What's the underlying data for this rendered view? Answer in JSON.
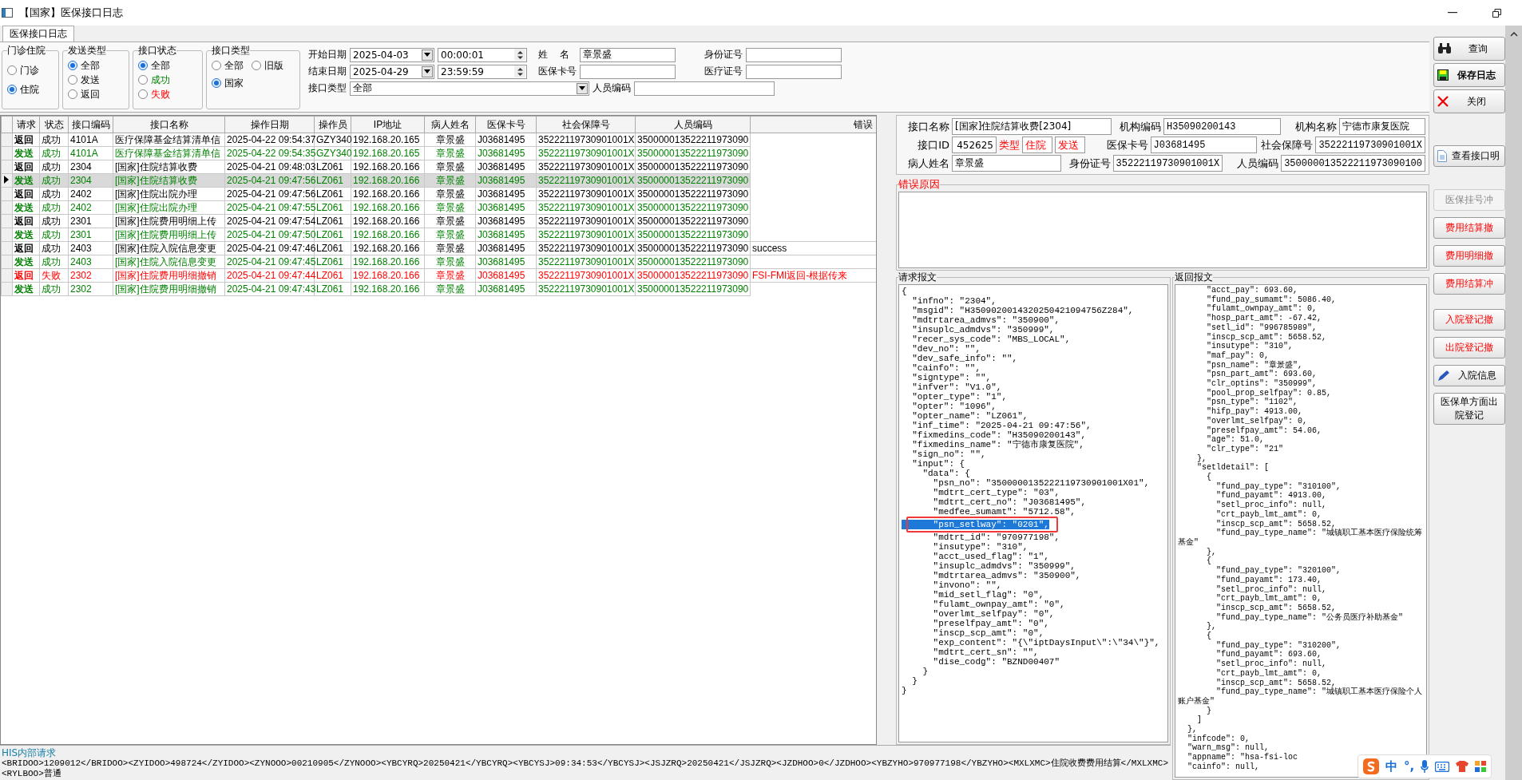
{
  "window": {
    "title": "【国家】医保接口日志"
  },
  "tabs": [
    {
      "label": "医保接口日志",
      "selected": true
    }
  ],
  "filters": {
    "groups": [
      {
        "title": "门诊住院",
        "options": [
          {
            "label": "门诊",
            "selected": false
          },
          {
            "label": "住院",
            "selected": true
          }
        ]
      },
      {
        "title": "发送类型",
        "options": [
          {
            "label": "全部",
            "selected": true
          },
          {
            "label": "发送",
            "selected": false
          },
          {
            "label": "返回",
            "selected": false
          }
        ]
      },
      {
        "title": "接口状态",
        "options": [
          {
            "label": "全部",
            "selected": true
          },
          {
            "label": "成功",
            "selected": false,
            "color": "#008000"
          },
          {
            "label": "失败",
            "selected": false,
            "color": "#ff0000"
          }
        ]
      },
      {
        "title": "接口类型",
        "options": [
          {
            "label": "全部",
            "selected": false
          },
          {
            "label": "旧版",
            "selected": false
          },
          {
            "label": "国家",
            "selected": true
          }
        ]
      }
    ],
    "start_label": "开始日期",
    "start_date": "2025-04-03",
    "start_time": "00:00:01",
    "end_label": "结束日期",
    "end_date": "2025-04-29",
    "end_time": "23:59:59",
    "type_label": "接口类型",
    "type_value": "全部",
    "name_label": "姓    名",
    "name_value": "章景盛",
    "card_label": "医保卡号",
    "id_label": "身份证号",
    "medical_label": "医疗证号",
    "person_label": "人员编码"
  },
  "table": {
    "columns": [
      "请求",
      "状态",
      "接口编码",
      "接口名称",
      "操作日期",
      "操作员",
      "IP地址",
      "病人姓名",
      "医保卡号",
      "社会保障号",
      "人员编码",
      "错误"
    ],
    "rows": [
      {
        "kind": "return",
        "selected": false,
        "cells": [
          "返回",
          "成功",
          "4101A",
          "医疗保障基金结算清单信",
          "2025-04-22 09:54:37",
          "GZY340",
          "192.168.20.165",
          "章景盛",
          "J03681495",
          "35222119730901001X",
          "350000013522211973090"
        ]
      },
      {
        "kind": "send",
        "selected": false,
        "cells": [
          "发送",
          "成功",
          "4101A",
          "医疗保障基金结算清单信",
          "2025-04-22 09:54:35",
          "GZY340",
          "192.168.20.165",
          "章景盛",
          "J03681495",
          "35222119730901001X",
          "350000013522211973090"
        ]
      },
      {
        "kind": "return",
        "selected": false,
        "cells": [
          "返回",
          "成功",
          "2304",
          "[国家]住院结算收费",
          "2025-04-21 09:48:03",
          "LZ061",
          "192.168.20.166",
          "章景盛",
          "J03681495",
          "35222119730901001X",
          "350000013522211973090"
        ]
      },
      {
        "kind": "send",
        "selected": true,
        "cells": [
          "发送",
          "成功",
          "2304",
          "[国家]住院结算收费",
          "2025-04-21 09:47:56",
          "LZ061",
          "192.168.20.166",
          "章景盛",
          "J03681495",
          "35222119730901001X",
          "350000013522211973090"
        ]
      },
      {
        "kind": "return",
        "selected": false,
        "cells": [
          "返回",
          "成功",
          "2402",
          "[国家]住院出院办理",
          "2025-04-21 09:47:56",
          "LZ061",
          "192.168.20.166",
          "章景盛",
          "J03681495",
          "35222119730901001X",
          "350000013522211973090"
        ]
      },
      {
        "kind": "send",
        "selected": false,
        "cells": [
          "发送",
          "成功",
          "2402",
          "[国家]住院出院办理",
          "2025-04-21 09:47:55",
          "LZ061",
          "192.168.20.166",
          "章景盛",
          "J03681495",
          "35222119730901001X",
          "350000013522211973090"
        ]
      },
      {
        "kind": "return",
        "selected": false,
        "cells": [
          "返回",
          "成功",
          "2301",
          "[国家]住院费用明细上传",
          "2025-04-21 09:47:54",
          "LZ061",
          "192.168.20.166",
          "章景盛",
          "J03681495",
          "35222119730901001X",
          "350000013522211973090"
        ]
      },
      {
        "kind": "send",
        "selected": false,
        "cells": [
          "发送",
          "成功",
          "2301",
          "[国家]住院费用明细上传",
          "2025-04-21 09:47:50",
          "LZ061",
          "192.168.20.166",
          "章景盛",
          "J03681495",
          "35222119730901001X",
          "350000013522211973090"
        ]
      },
      {
        "kind": "return",
        "selected": false,
        "cells": [
          "返回",
          "成功",
          "2403",
          "[国家]住院入院信息变更",
          "2025-04-21 09:47:46",
          "LZ061",
          "192.168.20.166",
          "章景盛",
          "J03681495",
          "35222119730901001X",
          "350000013522211973090",
          "success"
        ]
      },
      {
        "kind": "send",
        "selected": false,
        "cells": [
          "发送",
          "成功",
          "2403",
          "[国家]住院入院信息变更",
          "2025-04-21 09:47:45",
          "LZ061",
          "192.168.20.166",
          "章景盛",
          "J03681495",
          "35222119730901001X",
          "350000013522211973090"
        ]
      },
      {
        "kind": "failed",
        "selected": false,
        "cells": [
          "返回",
          "失败",
          "2302",
          "[国家]住院费用明细撤销",
          "2025-04-21 09:47:44",
          "LZ061",
          "192.168.20.166",
          "章景盛",
          "J03681495",
          "35222119730901001X",
          "350000013522211973090",
          "FSI-FMI返回-根据传来"
        ]
      },
      {
        "kind": "send",
        "selected": false,
        "cells": [
          "发送",
          "成功",
          "2302",
          "[国家]住院费用明细撤销",
          "2025-04-21 09:47:43",
          "LZ061",
          "192.168.20.166",
          "章景盛",
          "J03681495",
          "35222119730901001X",
          "350000013522211973090"
        ]
      }
    ]
  },
  "detail": {
    "rows": [
      {
        "cells": [
          {
            "label": "接口名称",
            "value": "[国家]住院结算收费[2304]"
          },
          {
            "label": "机构编码",
            "value": "H35090200143"
          },
          {
            "label": "机构名称",
            "value": "宁德市康复医院"
          }
        ]
      },
      {
        "cells": [
          {
            "label": "接口ID",
            "value": "452625",
            "kind": "id"
          },
          {
            "label": "医保卡号",
            "value": "J03681495"
          },
          {
            "label": "社会保障号",
            "value": "35222119730901001X"
          }
        ]
      },
      {
        "cells": [
          {
            "label": "病人姓名",
            "value": "章景盛"
          },
          {
            "label": "身份证号",
            "value": "35222119730901001X"
          },
          {
            "label": "人员编码",
            "value": "350000013522211973090100"
          }
        ]
      }
    ],
    "type_label": "类型",
    "visit_type": "住院",
    "direction": "发送",
    "error_title": "错误原因"
  },
  "request": {
    "title": "请求报文",
    "lines": [
      {
        "text": "{",
        "selected": false
      },
      {
        "text": "  \"infno\": \"2304\",",
        "selected": false
      },
      {
        "text": "  \"msgid\": \"H3509020014320250421094756Z284\",",
        "selected": false
      },
      {
        "text": "  \"mdtrtarea_admvs\": \"350900\",",
        "selected": false
      },
      {
        "text": "  \"insuplc_admdvs\": \"350999\",",
        "selected": false
      },
      {
        "text": "  \"recer_sys_code\": \"MBS_LOCAL\",",
        "selected": false
      },
      {
        "text": "  \"dev_no\": \"\",",
        "selected": false
      },
      {
        "text": "  \"dev_safe_info\": \"\",",
        "selected": false
      },
      {
        "text": "  \"cainfo\": \"\",",
        "selected": false
      },
      {
        "text": "  \"signtype\": \"\",",
        "selected": false
      },
      {
        "text": "  \"infver\": \"V1.0\",",
        "selected": false
      },
      {
        "text": "  \"opter_type\": \"1\",",
        "selected": false
      },
      {
        "text": "  \"opter\": \"1096\",",
        "selected": false
      },
      {
        "text": "  \"opter_name\": \"LZ061\",",
        "selected": false
      },
      {
        "text": "  \"inf_time\": \"2025-04-21 09:47:56\",",
        "selected": false
      },
      {
        "text": "  \"fixmedins_code\": \"H35090200143\",",
        "selected": false
      },
      {
        "text": "  \"fixmedins_name\": \"宁德市康复医院\",",
        "selected": false
      },
      {
        "text": "  \"sign_no\": \"\",",
        "selected": false
      },
      {
        "text": "  \"input\": {",
        "selected": false
      },
      {
        "text": "    \"data\": {",
        "selected": false
      },
      {
        "text": "      \"psn_no\": \"3500000135222119730901001X01\",",
        "selected": false
      },
      {
        "text": "      \"mdtrt_cert_type\": \"03\",",
        "selected": false
      },
      {
        "text": "      \"mdtrt_cert_no\": \"J03681495\",",
        "selected": false
      },
      {
        "text": "      \"medfee_sumamt\": \"5712.58\",",
        "selected": false
      },
      {
        "text": "      \"psn_setlway\": \"0201\",",
        "selected": true
      },
      {
        "text": "      \"mdtrt_id\": \"970977198\",",
        "selected": false
      },
      {
        "text": "      \"insutype\": \"310\",",
        "selected": false
      },
      {
        "text": "      \"acct_used_flag\": \"1\",",
        "selected": false
      },
      {
        "text": "      \"insuplc_admdvs\": \"350999\",",
        "selected": false
      },
      {
        "text": "      \"mdtrtarea_admvs\": \"350900\",",
        "selected": false
      },
      {
        "text": "      \"invono\": \"\",",
        "selected": false
      },
      {
        "text": "      \"mid_setl_flag\": \"0\",",
        "selected": false
      },
      {
        "text": "      \"fulamt_ownpay_amt\": \"0\",",
        "selected": false
      },
      {
        "text": "      \"overlmt_selfpay\": \"0\",",
        "selected": false
      },
      {
        "text": "      \"preselfpay_amt\": \"0\",",
        "selected": false
      },
      {
        "text": "      \"inscp_scp_amt\": \"0\",",
        "selected": false
      },
      {
        "text": "      \"exp_content\": \"{\\\"iptDaysInput\\\":\\\"34\\\"}\",",
        "selected": false
      },
      {
        "text": "      \"mdtrt_cert_sn\": \"\",",
        "selected": false
      },
      {
        "text": "      \"dise_codg\": \"BZND00407\"",
        "selected": false
      },
      {
        "text": "    }",
        "selected": false
      },
      {
        "text": "  }",
        "selected": false
      },
      {
        "text": "}",
        "selected": false
      }
    ]
  },
  "response": {
    "title": "返回报文",
    "lines": [
      "      \"acct_pay\": 693.60,",
      "      \"fund_pay_sumamt\": 5086.40,",
      "      \"fulamt_ownpay_amt\": 0,",
      "      \"hosp_part_amt\": -67.42,",
      "      \"setl_id\": \"996785989\",",
      "      \"inscp_scp_amt\": 5658.52,",
      "      \"insutype\": \"310\",",
      "      \"maf_pay\": 0,",
      "      \"psn_name\": \"章景盛\",",
      "      \"psn_part_amt\": 693.60,",
      "      \"clr_optins\": \"350999\",",
      "      \"pool_prop_selfpay\": 0.85,",
      "      \"psn_type\": \"1102\",",
      "      \"hifp_pay\": 4913.00,",
      "      \"overlmt_selfpay\": 0,",
      "      \"preselfpay_amt\": 54.06,",
      "      \"age\": 51.0,",
      "      \"clr_type\": \"21\"",
      "    },",
      "    \"setldetail\": [",
      "      {",
      "        \"fund_pay_type\": \"310100\",",
      "        \"fund_payamt\": 4913.00,",
      "        \"setl_proc_info\": null,",
      "        \"crt_payb_lmt_amt\": 0,",
      "        \"inscp_scp_amt\": 5658.52,",
      "        \"fund_pay_type_name\": \"城镇职工基本医疗保险统筹基金\"",
      "      },",
      "      {",
      "        \"fund_pay_type\": \"320100\",",
      "        \"fund_payamt\": 173.40,",
      "        \"setl_proc_info\": null,",
      "        \"crt_payb_lmt_amt\": 0,",
      "        \"inscp_scp_amt\": 5658.52,",
      "        \"fund_pay_type_name\": \"公务员医疗补助基金\"",
      "      },",
      "      {",
      "        \"fund_pay_type\": \"310200\",",
      "        \"fund_payamt\": 693.60,",
      "        \"setl_proc_info\": null,",
      "        \"crt_payb_lmt_amt\": 0,",
      "        \"inscp_scp_amt\": 5658.52,",
      "        \"fund_pay_type_name\": \"城镇职工基本医疗保险个人账户基金\"",
      "      }",
      "    ]",
      "  },",
      "  \"infcode\": 0,",
      "  \"warn_msg\": null,",
      "  \"appname\": \"hsa-fsi-loc",
      "  \"cainfo\": null,"
    ]
  },
  "button_groups": [
    [
      {
        "label": "查询",
        "kind": "normal",
        "disabled": false
      },
      {
        "label": "保存日志",
        "kind": "bold",
        "disabled": false
      },
      {
        "label": "关闭",
        "kind": "normal",
        "disabled": false
      }
    ],
    [
      {
        "label": "查看接口明",
        "kind": "normal",
        "disabled": false
      }
    ],
    [
      {
        "label": "医保挂号冲",
        "kind": "normal",
        "disabled": true
      },
      {
        "label": "费用结算撤",
        "kind": "danger",
        "disabled": false
      },
      {
        "label": "费用明细撤",
        "kind": "danger",
        "disabled": false
      },
      {
        "label": "费用结算冲",
        "kind": "danger",
        "disabled": false
      }
    ],
    [
      {
        "label": "入院登记撤",
        "kind": "danger",
        "disabled": false
      },
      {
        "label": "出院登记撤",
        "kind": "danger",
        "disabled": false
      },
      {
        "label": "入院信息",
        "kind": "normal",
        "disabled": false
      },
      {
        "label": "医保单方面出院登记",
        "kind": "normal",
        "disabled": false
      }
    ]
  ],
  "his_request": {
    "title": "HIS内部请求",
    "text": "<BRIDOO>1209012</BRIDOO><ZYIDOO>498724</ZYIDOO><ZYNOOO>00210905</ZYNOOO><YBCYRQ>20250421</YBCYRQ><YBCYSJ>09:34:53</YBCYSJ><JSJZRQ>20250421</JSJZRQ><JZDHOO>0</JZDHOO><YBZYHO>970977198</YBZYHO><MXLXMC>住院收费费用结算</MXLXMC><RYLBOO>普通"
  },
  "ime": {
    "mode": "中",
    "punctuation": "°,"
  }
}
